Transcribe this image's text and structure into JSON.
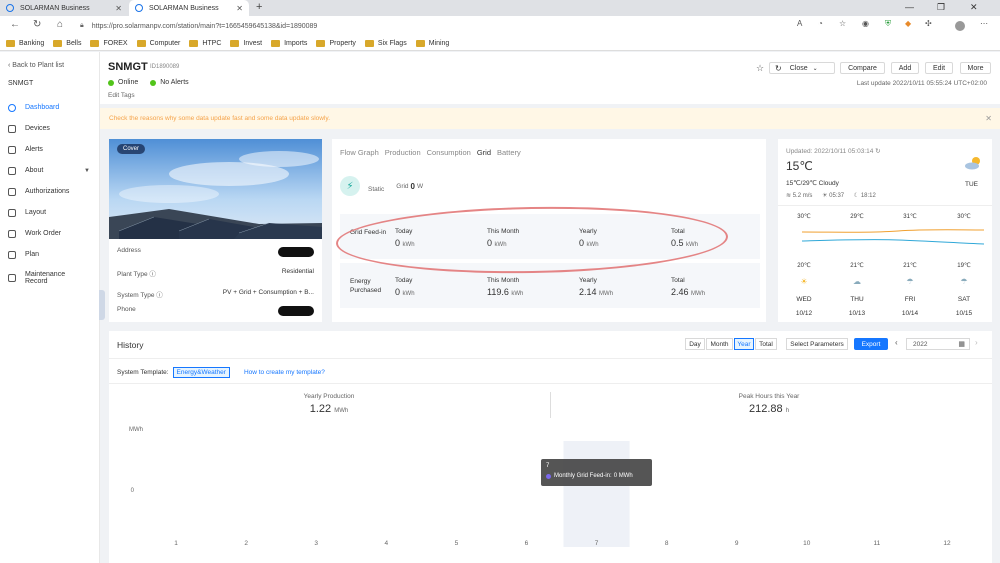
{
  "browser": {
    "tabs": [
      {
        "title": "SOLARMAN Business"
      },
      {
        "title": "SOLARMAN Business"
      }
    ],
    "url": "https://pro.solarmanpv.com/station/main?t=1665459645138&id=1890089",
    "bookmarks": [
      "Banking",
      "Bells",
      "FOREX",
      "Computer",
      "HTPC",
      "Invest",
      "Imports",
      "Property",
      "Six Flags",
      "Mining"
    ]
  },
  "sidebar": {
    "back_label": "Back to Plant list",
    "plant_code": "SNMGT",
    "items": [
      {
        "label": "Dashboard"
      },
      {
        "label": "Devices"
      },
      {
        "label": "Alerts"
      },
      {
        "label": "About"
      },
      {
        "label": "Authorizations"
      },
      {
        "label": "Layout"
      },
      {
        "label": "Work Order"
      },
      {
        "label": "Plan"
      },
      {
        "label": "Maintenance Record"
      }
    ]
  },
  "header": {
    "plant_name": "SNMGT",
    "plant_id": "ID1890089",
    "status_online": "Online",
    "status_alerts": "No Alerts",
    "edit_tags": "Edit Tags",
    "close_label": "Close",
    "buttons": [
      "Compare",
      "Add",
      "Edit",
      "More"
    ],
    "last_update": "Last update 2022/10/11 05:55:24 UTC+02:00"
  },
  "warning": "Check the reasons why some data update fast and some data update slowly.",
  "plant_card": {
    "cover": "Cover",
    "rows": [
      {
        "label": "Address",
        "value": ""
      },
      {
        "label": "Plant Type ⓘ",
        "value": "Residential"
      },
      {
        "label": "System Type ⓘ",
        "value": "PV + Grid + Consumption + B..."
      },
      {
        "label": "Phone",
        "value": ""
      }
    ]
  },
  "energy_card": {
    "tabs": [
      "Flow Graph",
      "Production",
      "Consumption",
      "Grid",
      "Battery"
    ],
    "selected_tab": "Grid",
    "static_label": "Static",
    "grid_label": "Grid",
    "grid_value": "0",
    "grid_unit": "W",
    "grid_feed_in": {
      "label": "Grid Feed-in",
      "cols": [
        {
          "head": "Today",
          "value": "0",
          "unit": "kWh"
        },
        {
          "head": "This Month",
          "value": "0",
          "unit": "kWh"
        },
        {
          "head": "Yearly",
          "value": "0",
          "unit": "kWh"
        },
        {
          "head": "Total",
          "value": "0.5",
          "unit": "kWh"
        }
      ]
    },
    "energy_purchased": {
      "label": "Energy Purchased",
      "cols": [
        {
          "head": "Today",
          "value": "0",
          "unit": "kWh"
        },
        {
          "head": "This Month",
          "value": "119.6",
          "unit": "kWh"
        },
        {
          "head": "Yearly",
          "value": "2.14",
          "unit": "MWh"
        },
        {
          "head": "Total",
          "value": "2.46",
          "unit": "MWh"
        }
      ]
    }
  },
  "weather": {
    "updated": "Updated: 2022/10/11 05:03:14",
    "temp": "15℃",
    "range": "15℃/29℃ Cloudy",
    "wind": "5.2 m/s",
    "sunrise": "05:37",
    "sunset": "18:12",
    "today": "TUE",
    "highs": [
      "30℃",
      "29℃",
      "31℃",
      "30℃"
    ],
    "lows": [
      "20℃",
      "21℃",
      "21℃",
      "19℃"
    ],
    "days": [
      "WED",
      "THU",
      "FRI",
      "SAT"
    ],
    "dates": [
      "10/12",
      "10/13",
      "10/14",
      "10/15"
    ]
  },
  "history": {
    "title": "History",
    "ranges": [
      "Day",
      "Month",
      "Year",
      "Total"
    ],
    "selected_range": "Year",
    "select_params": "Select Parameters",
    "export": "Export",
    "year": "2022",
    "template_label": "System Template:",
    "template_chip": "Energy&Weather",
    "template_link": "How to create my template?",
    "yearly_production_label": "Yearly Production",
    "yearly_production_value": "1.22",
    "yearly_production_unit": "MWh",
    "peak_hours_label": "Peak Hours this Year",
    "peak_hours_value": "212.88",
    "peak_hours_unit": "h",
    "tooltip_title": "7",
    "tooltip_series": "Monthly Grid Feed-in:",
    "tooltip_value": "0 MWh"
  },
  "chart_data": {
    "type": "bar",
    "ylabel": "MWh",
    "categories": [
      "1",
      "2",
      "3",
      "4",
      "5",
      "6",
      "7",
      "8",
      "9",
      "10",
      "11",
      "12"
    ],
    "y_ticks": [
      "0"
    ],
    "series": [
      {
        "name": "Monthly Grid Feed-in",
        "values": [
          0,
          0,
          0,
          0,
          0,
          0,
          0,
          0,
          0,
          0,
          0,
          0
        ]
      }
    ],
    "highlighted_category": "7"
  },
  "colors": {
    "accent": "#1677ff",
    "online": "#52c41a",
    "warning_bg": "#fff7e6",
    "warning_text": "#f5a34a",
    "annotation": "#e07070",
    "high_line": "#f0a030",
    "low_line": "#30a8d8"
  }
}
